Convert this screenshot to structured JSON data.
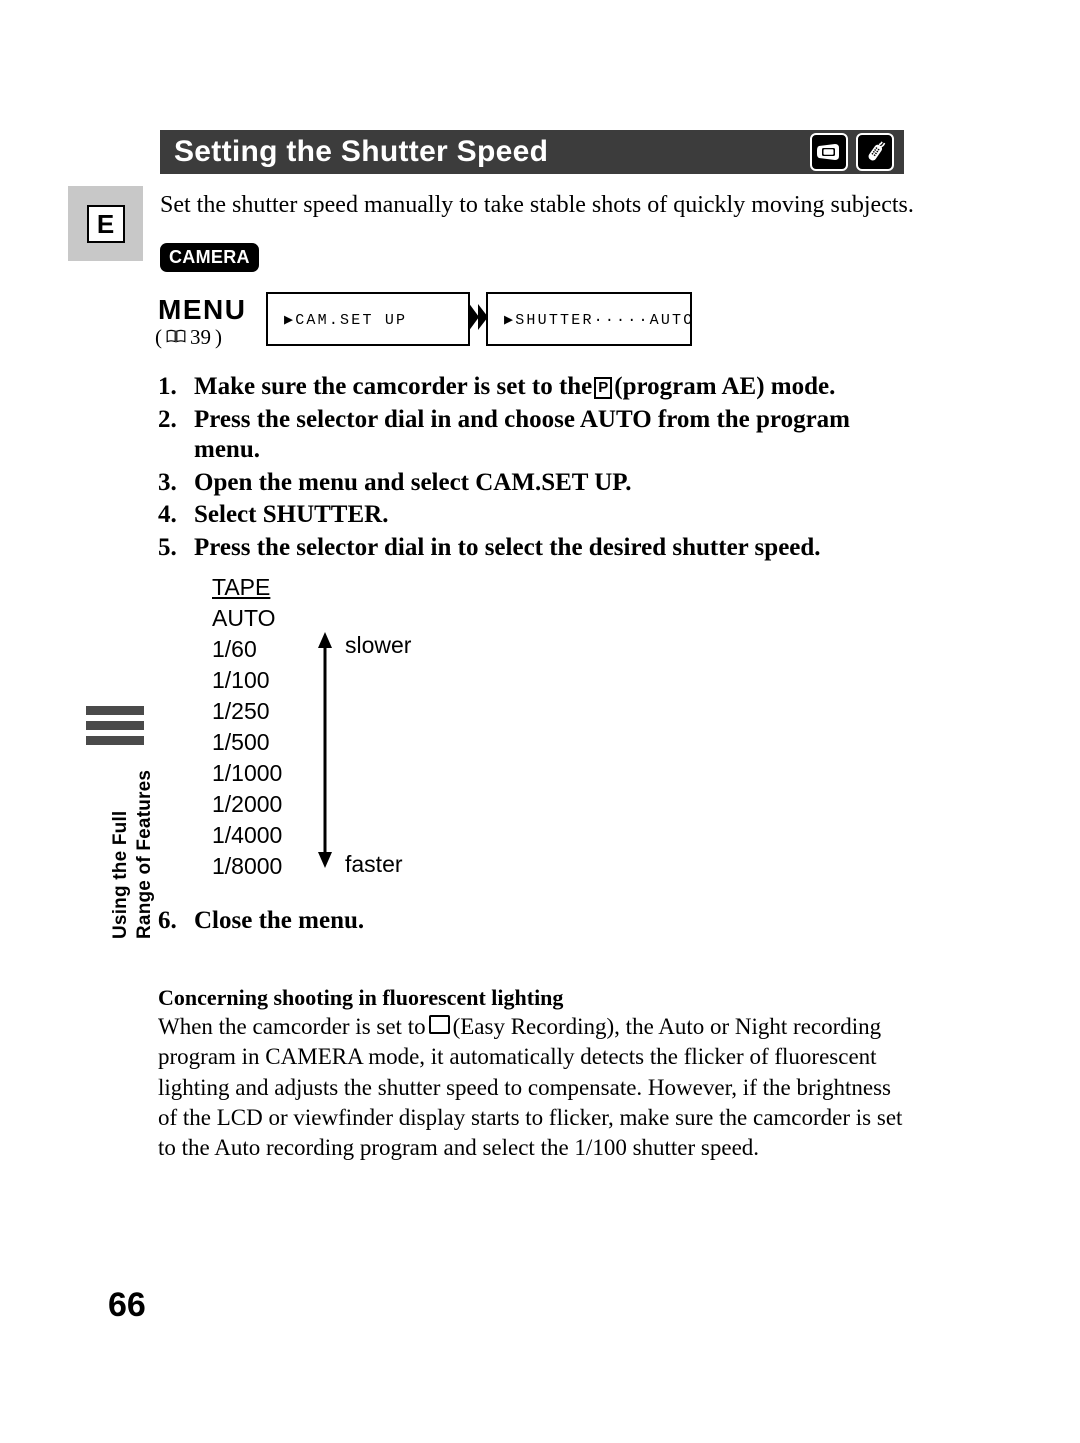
{
  "language_tab": {
    "label": "E"
  },
  "chapter_tab": {
    "line1": "Using the Full",
    "line2": "Range of Features",
    "bar_color": "#4a4a4a"
  },
  "page_number": "66",
  "header": {
    "title": "Setting the Shutter Speed",
    "background": "#3c3c3c",
    "icons": [
      {
        "name": "camcorder-icon",
        "label": "camcorder"
      },
      {
        "name": "wireless-controller-icon",
        "label": "wireless controller"
      }
    ]
  },
  "intro": "Set the shutter speed manually to take stable shots of quickly moving subjects.",
  "mode_badge": {
    "label": "CAMERA"
  },
  "menu": {
    "label": "MENU",
    "reference_open": "(",
    "reference_page": "39",
    "reference_close": ")",
    "screens": [
      {
        "name": "cam-set-up",
        "text": "▶CAM.SET UP"
      },
      {
        "name": "shutter-auto",
        "text": "▶SHUTTER·····AUTO"
      }
    ]
  },
  "steps": [
    {
      "number": "1.",
      "before": "Make sure the camcorder is set to the",
      "symbol": "P",
      "after": "(program AE) mode."
    },
    {
      "number": "2.",
      "before": "Press the selector dial in and choose AUTO from the program menu.",
      "symbol": "",
      "after": ""
    },
    {
      "number": "3.",
      "before": "Open the menu and select CAM.SET UP.",
      "symbol": "",
      "after": ""
    },
    {
      "number": "4.",
      "before": "Select SHUTTER.",
      "symbol": "",
      "after": ""
    },
    {
      "number": "5.",
      "before": "Press the selector dial in to select the desired shutter speed.",
      "symbol": "",
      "after": ""
    }
  ],
  "step6": {
    "number": "6.",
    "text": "Close the menu."
  },
  "tape": {
    "title": "TAPE",
    "speeds": [
      "AUTO",
      "1/60",
      "1/100",
      "1/250",
      "1/500",
      "1/1000",
      "1/2000",
      "1/4000",
      "1/8000"
    ],
    "arrow_top_label": "slower",
    "arrow_bottom_label": "faster"
  },
  "note": {
    "title": "Concerning shooting in fluorescent lighting",
    "body_before": "When the camcorder is set to",
    "body_after": "(Easy Recording), the Auto or Night recording program in CAMERA mode, it automatically detects the flicker of fluorescent lighting and adjusts the shutter speed to compensate. However, if the brightness of the LCD or viewfinder display starts to flicker, make sure the camcorder is set to the Auto recording program and select the 1/100 shutter speed."
  }
}
